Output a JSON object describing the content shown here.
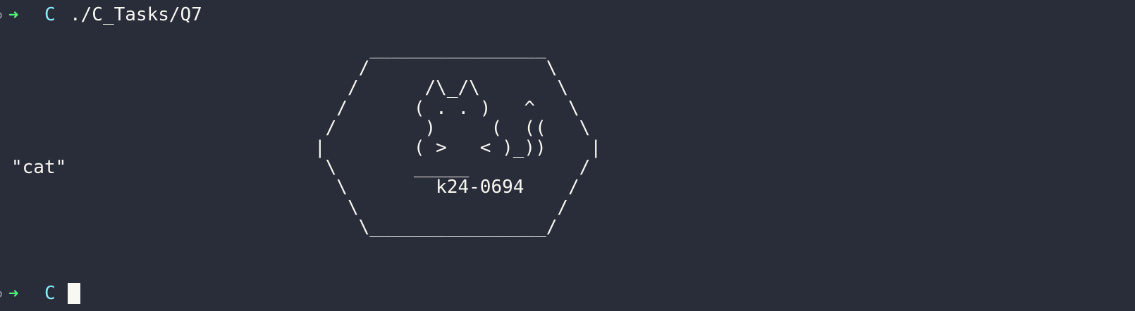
{
  "colors": {
    "background": "#292c39",
    "prompt_arrow": "#50fa7b",
    "directory": "#8be9fd",
    "text": "#f8f8f2"
  },
  "prompt1": {
    "arrow": "➜",
    "dir": "C",
    "command": "./C_Tasks/Q7"
  },
  "output": {
    "word": "\"cat\"",
    "ascii_art": "     ________________\n    /                \\\n   /      /\\_/\\       \\\n  /      ( . . )   ^   \\\n /        )     (  ((   \\\n|        ( >   < )_))    |\n \\       _____          /\n  \\        k24-0694    /\n   \\                  /\n    \\________________/"
  },
  "prompt2": {
    "arrow": "➜",
    "dir": "C"
  }
}
